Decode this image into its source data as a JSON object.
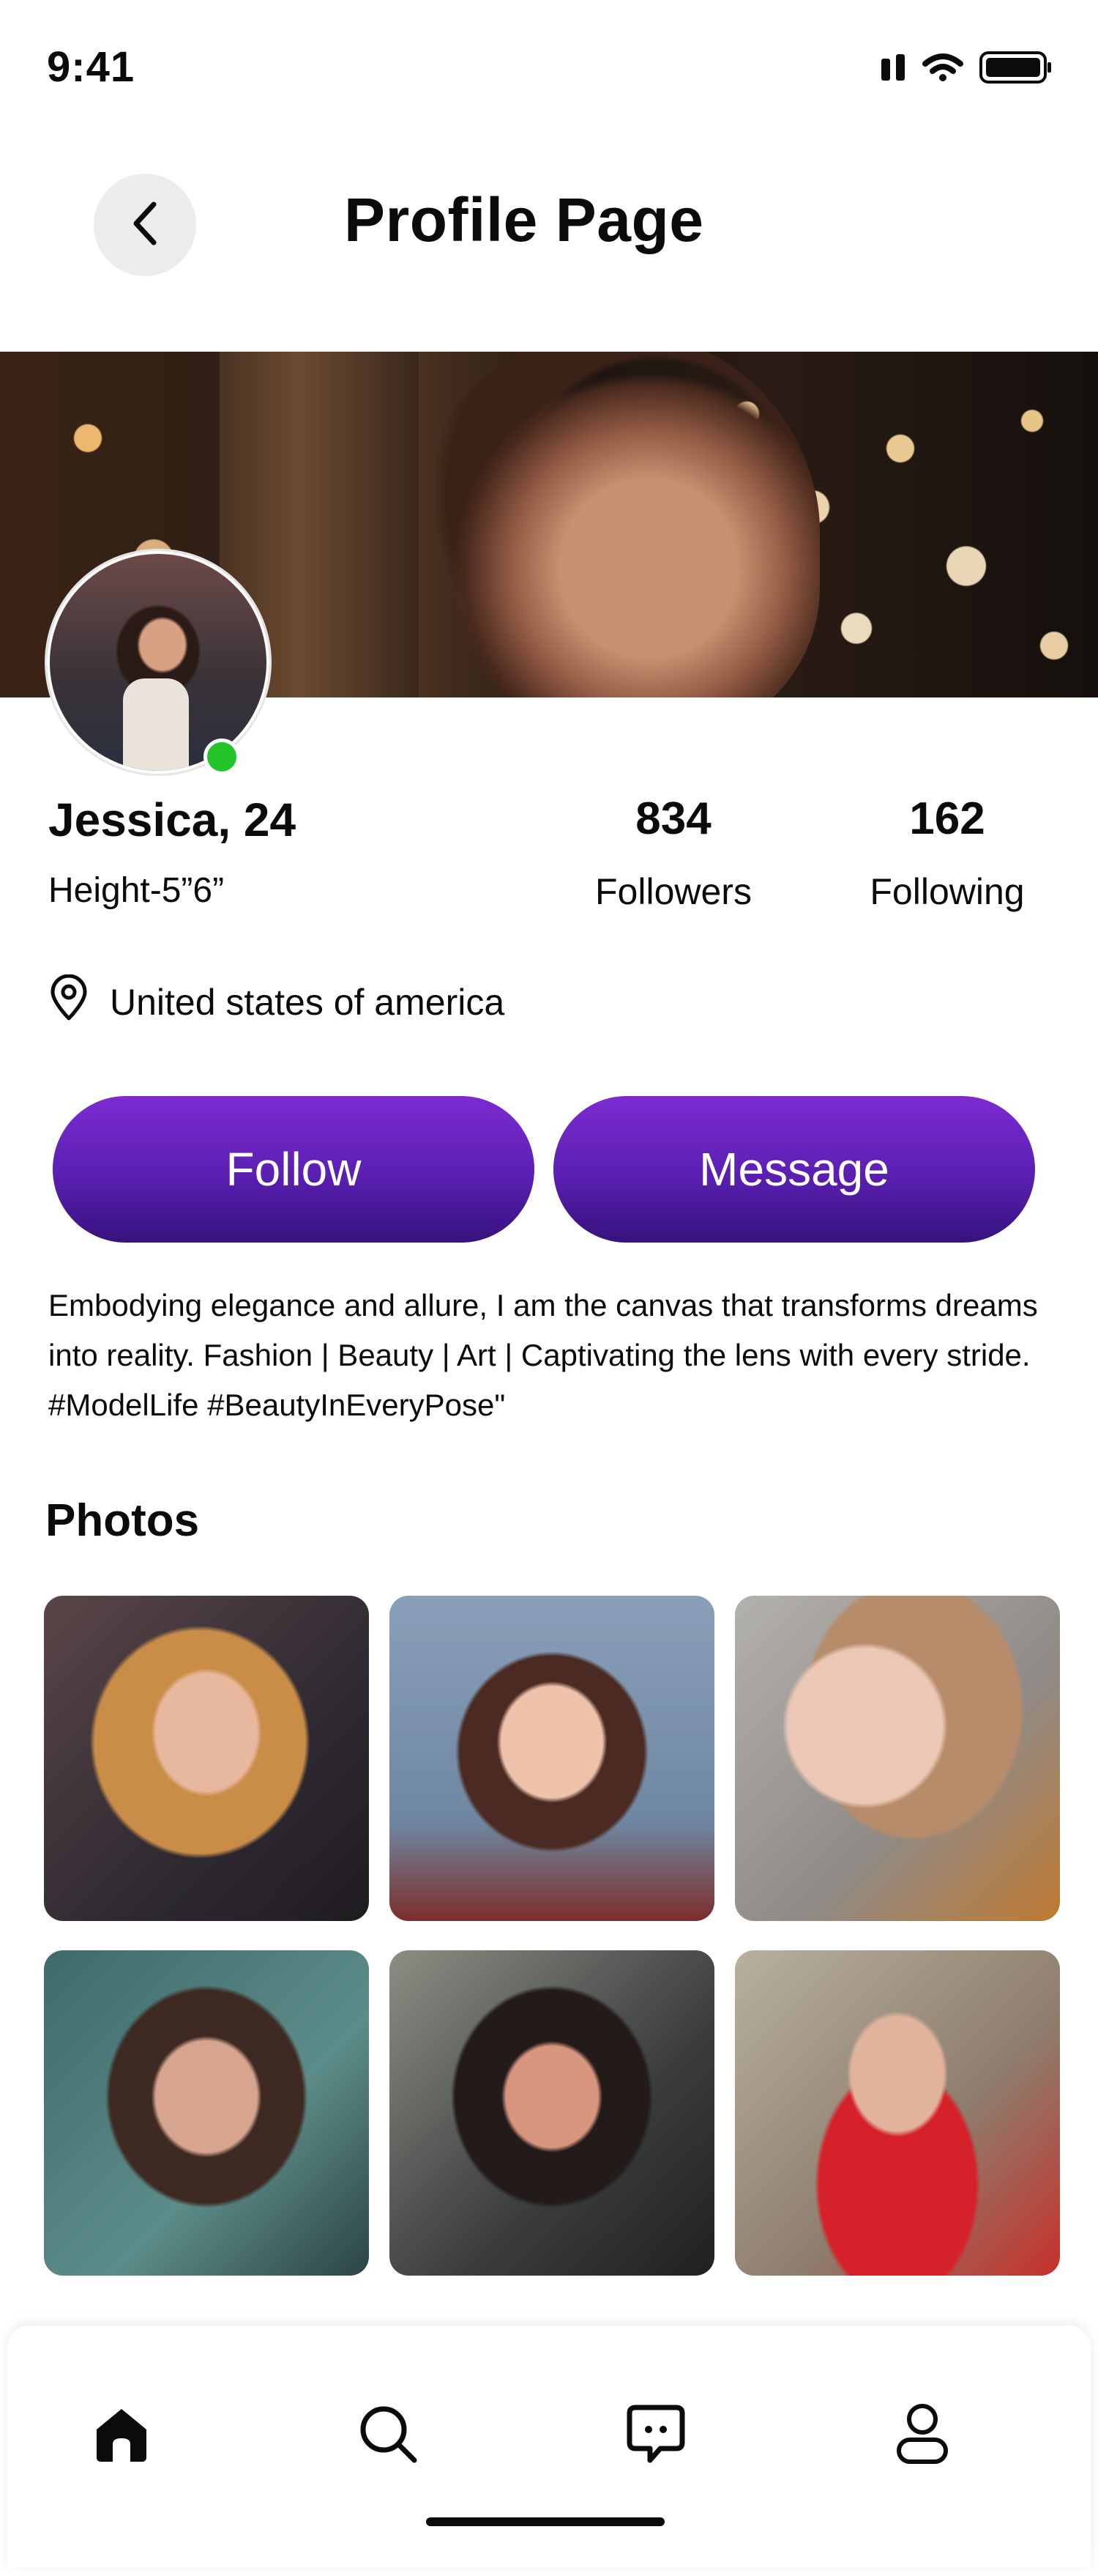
{
  "status_bar": {
    "time": "9:41",
    "icons": [
      "signal-icon",
      "wifi-icon",
      "battery-icon"
    ]
  },
  "header": {
    "title": "Profile Page",
    "back_icon": "chevron-left-icon"
  },
  "profile": {
    "name": "Jessica, 24",
    "height": "Height-5”6”",
    "online": true,
    "stats": [
      {
        "value": "834",
        "label": "Followers"
      },
      {
        "value": "162",
        "label": "Following"
      }
    ],
    "location": "United states of america"
  },
  "actions": {
    "follow_label": "Follow",
    "message_label": "Message"
  },
  "bio": "Embodying elegance and allure, I am the canvas that transforms dreams into reality. Fashion | Beauty | Art | Captivating the lens with every stride.  #ModelLife #BeautyInEveryPose\"",
  "photos": {
    "title": "Photos",
    "count": 6
  },
  "bottom_nav": {
    "items": [
      "home-icon",
      "search-icon",
      "chat-icon",
      "profile-icon"
    ],
    "active": "home-icon"
  },
  "colors": {
    "accent_top": "#7d2bd2",
    "accent_bottom": "#36127c",
    "online": "#23c52a",
    "text": "#0b0b0b"
  }
}
